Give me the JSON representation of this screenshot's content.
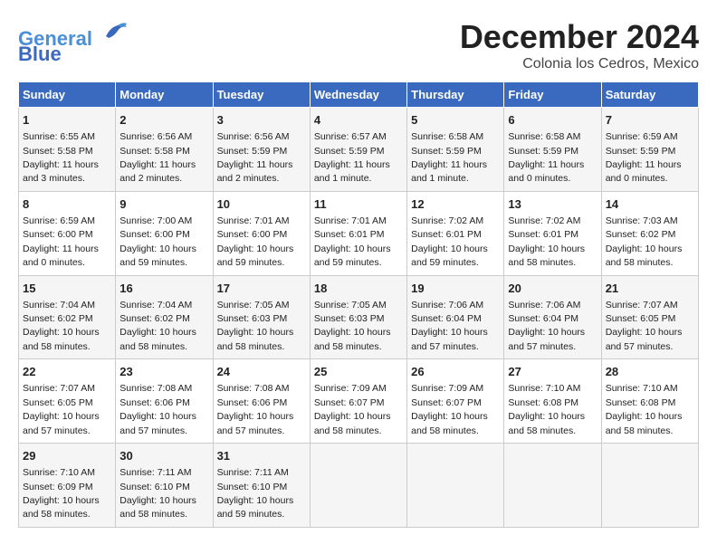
{
  "header": {
    "logo_line1": "General",
    "logo_line2": "Blue",
    "month": "December 2024",
    "location": "Colonia los Cedros, Mexico"
  },
  "weekdays": [
    "Sunday",
    "Monday",
    "Tuesday",
    "Wednesday",
    "Thursday",
    "Friday",
    "Saturday"
  ],
  "weeks": [
    [
      {
        "day": "1",
        "info": "Sunrise: 6:55 AM\nSunset: 5:58 PM\nDaylight: 11 hours\nand 3 minutes."
      },
      {
        "day": "2",
        "info": "Sunrise: 6:56 AM\nSunset: 5:58 PM\nDaylight: 11 hours\nand 2 minutes."
      },
      {
        "day": "3",
        "info": "Sunrise: 6:56 AM\nSunset: 5:59 PM\nDaylight: 11 hours\nand 2 minutes."
      },
      {
        "day": "4",
        "info": "Sunrise: 6:57 AM\nSunset: 5:59 PM\nDaylight: 11 hours\nand 1 minute."
      },
      {
        "day": "5",
        "info": "Sunrise: 6:58 AM\nSunset: 5:59 PM\nDaylight: 11 hours\nand 1 minute."
      },
      {
        "day": "6",
        "info": "Sunrise: 6:58 AM\nSunset: 5:59 PM\nDaylight: 11 hours\nand 0 minutes."
      },
      {
        "day": "7",
        "info": "Sunrise: 6:59 AM\nSunset: 5:59 PM\nDaylight: 11 hours\nand 0 minutes."
      }
    ],
    [
      {
        "day": "8",
        "info": "Sunrise: 6:59 AM\nSunset: 6:00 PM\nDaylight: 11 hours\nand 0 minutes."
      },
      {
        "day": "9",
        "info": "Sunrise: 7:00 AM\nSunset: 6:00 PM\nDaylight: 10 hours\nand 59 minutes."
      },
      {
        "day": "10",
        "info": "Sunrise: 7:01 AM\nSunset: 6:00 PM\nDaylight: 10 hours\nand 59 minutes."
      },
      {
        "day": "11",
        "info": "Sunrise: 7:01 AM\nSunset: 6:01 PM\nDaylight: 10 hours\nand 59 minutes."
      },
      {
        "day": "12",
        "info": "Sunrise: 7:02 AM\nSunset: 6:01 PM\nDaylight: 10 hours\nand 59 minutes."
      },
      {
        "day": "13",
        "info": "Sunrise: 7:02 AM\nSunset: 6:01 PM\nDaylight: 10 hours\nand 58 minutes."
      },
      {
        "day": "14",
        "info": "Sunrise: 7:03 AM\nSunset: 6:02 PM\nDaylight: 10 hours\nand 58 minutes."
      }
    ],
    [
      {
        "day": "15",
        "info": "Sunrise: 7:04 AM\nSunset: 6:02 PM\nDaylight: 10 hours\nand 58 minutes."
      },
      {
        "day": "16",
        "info": "Sunrise: 7:04 AM\nSunset: 6:02 PM\nDaylight: 10 hours\nand 58 minutes."
      },
      {
        "day": "17",
        "info": "Sunrise: 7:05 AM\nSunset: 6:03 PM\nDaylight: 10 hours\nand 58 minutes."
      },
      {
        "day": "18",
        "info": "Sunrise: 7:05 AM\nSunset: 6:03 PM\nDaylight: 10 hours\nand 58 minutes."
      },
      {
        "day": "19",
        "info": "Sunrise: 7:06 AM\nSunset: 6:04 PM\nDaylight: 10 hours\nand 57 minutes."
      },
      {
        "day": "20",
        "info": "Sunrise: 7:06 AM\nSunset: 6:04 PM\nDaylight: 10 hours\nand 57 minutes."
      },
      {
        "day": "21",
        "info": "Sunrise: 7:07 AM\nSunset: 6:05 PM\nDaylight: 10 hours\nand 57 minutes."
      }
    ],
    [
      {
        "day": "22",
        "info": "Sunrise: 7:07 AM\nSunset: 6:05 PM\nDaylight: 10 hours\nand 57 minutes."
      },
      {
        "day": "23",
        "info": "Sunrise: 7:08 AM\nSunset: 6:06 PM\nDaylight: 10 hours\nand 57 minutes."
      },
      {
        "day": "24",
        "info": "Sunrise: 7:08 AM\nSunset: 6:06 PM\nDaylight: 10 hours\nand 57 minutes."
      },
      {
        "day": "25",
        "info": "Sunrise: 7:09 AM\nSunset: 6:07 PM\nDaylight: 10 hours\nand 58 minutes."
      },
      {
        "day": "26",
        "info": "Sunrise: 7:09 AM\nSunset: 6:07 PM\nDaylight: 10 hours\nand 58 minutes."
      },
      {
        "day": "27",
        "info": "Sunrise: 7:10 AM\nSunset: 6:08 PM\nDaylight: 10 hours\nand 58 minutes."
      },
      {
        "day": "28",
        "info": "Sunrise: 7:10 AM\nSunset: 6:08 PM\nDaylight: 10 hours\nand 58 minutes."
      }
    ],
    [
      {
        "day": "29",
        "info": "Sunrise: 7:10 AM\nSunset: 6:09 PM\nDaylight: 10 hours\nand 58 minutes."
      },
      {
        "day": "30",
        "info": "Sunrise: 7:11 AM\nSunset: 6:10 PM\nDaylight: 10 hours\nand 58 minutes."
      },
      {
        "day": "31",
        "info": "Sunrise: 7:11 AM\nSunset: 6:10 PM\nDaylight: 10 hours\nand 59 minutes."
      },
      {
        "day": "",
        "info": ""
      },
      {
        "day": "",
        "info": ""
      },
      {
        "day": "",
        "info": ""
      },
      {
        "day": "",
        "info": ""
      }
    ]
  ]
}
